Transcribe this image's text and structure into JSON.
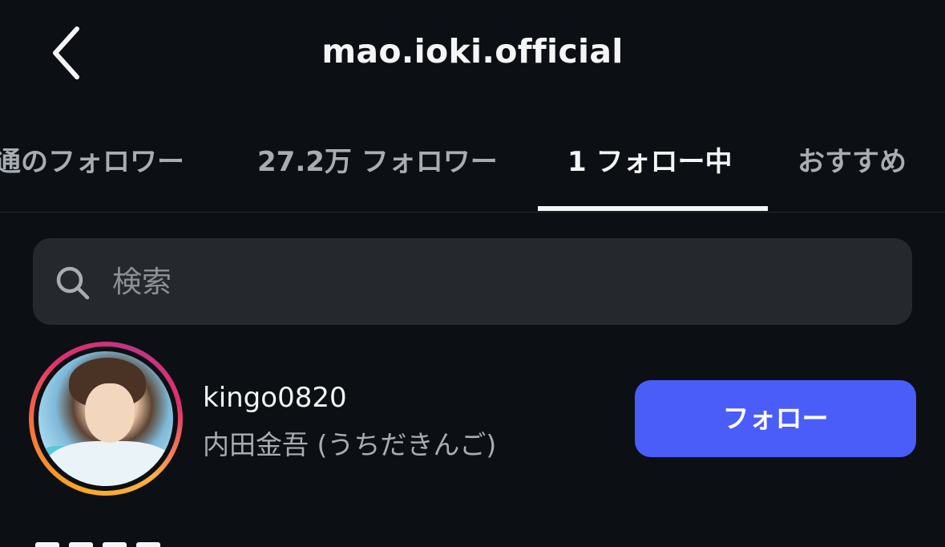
{
  "header": {
    "title": "mao.ioki.official",
    "back_icon": "chevron-left-icon"
  },
  "tabs": [
    {
      "label": "通のフォロワー",
      "active": false
    },
    {
      "label": "27.2万 フォロワー",
      "active": false
    },
    {
      "label": "1 フォロー中",
      "active": true
    },
    {
      "label": "おすすめ",
      "active": false
    }
  ],
  "search": {
    "placeholder": "検索",
    "value": "",
    "icon": "search-icon"
  },
  "users": [
    {
      "username": "kingo0820",
      "full_name": "内田金吾 (うちだきんご)",
      "button_label": "フォロー",
      "has_story_ring": true
    }
  ],
  "colors": {
    "background": "#0c1014",
    "search_background": "#25292e",
    "primary_text": "#f5f5f5",
    "secondary_text": "#a8adb3",
    "follow_button": "#4a5df9"
  }
}
